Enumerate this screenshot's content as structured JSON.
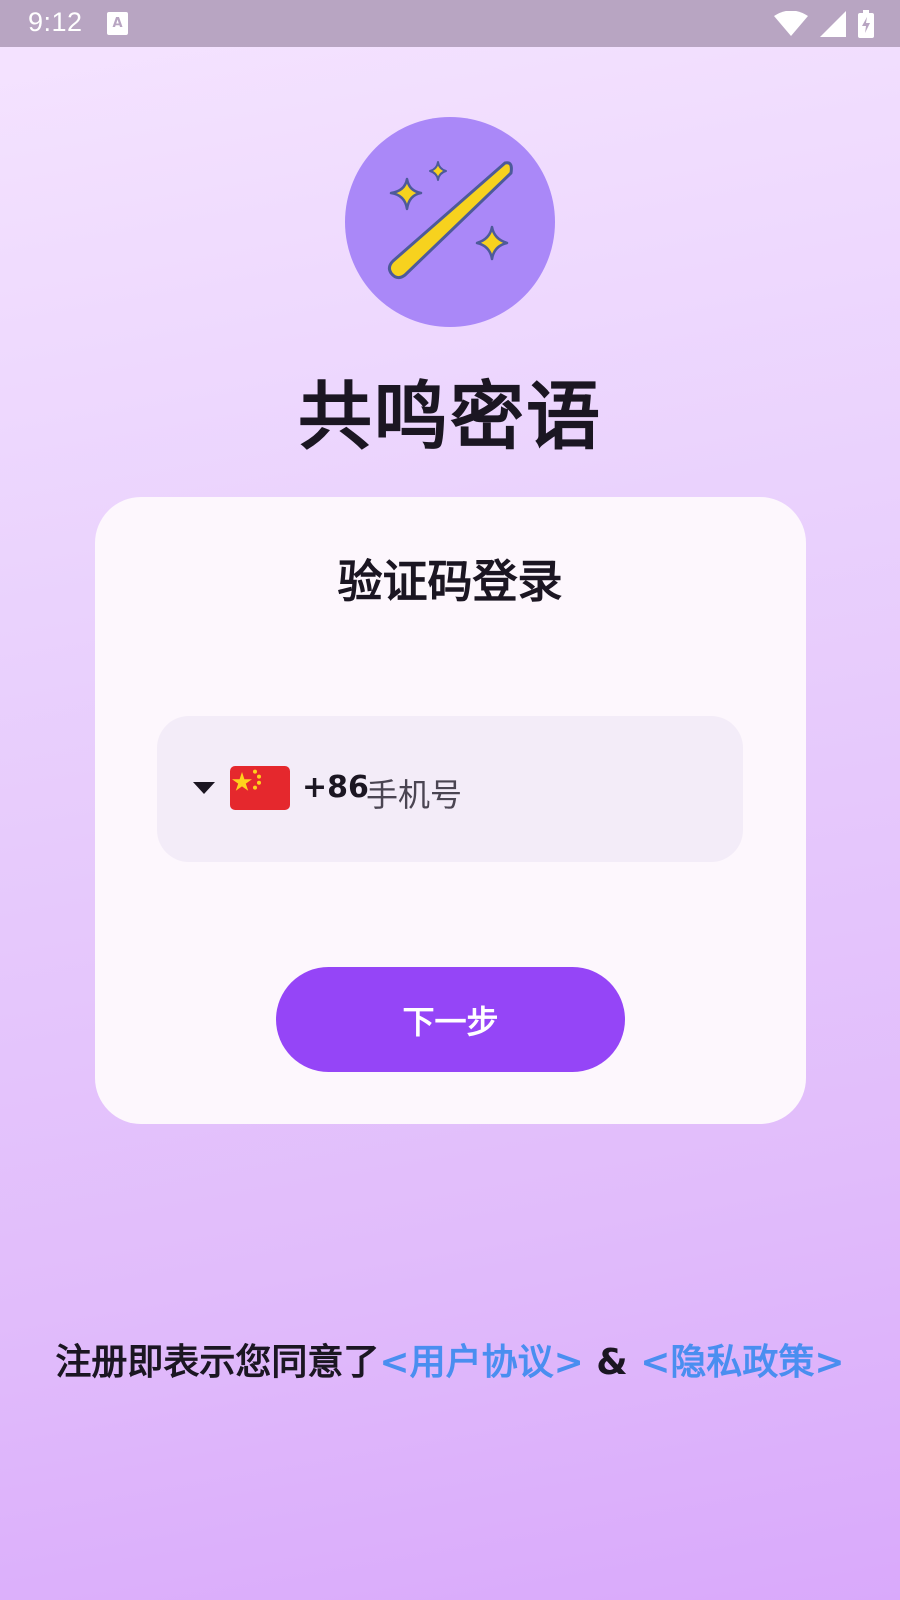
{
  "status_bar": {
    "time": "9:12"
  },
  "app": {
    "title": "共鸣密语",
    "logo_icon": "magic-wand-sparkles-icon"
  },
  "login": {
    "title": "验证码登录",
    "country": {
      "flag_icon": "china-flag-icon",
      "code": "+86"
    },
    "phone_placeholder": "手机号",
    "phone_value": "",
    "next_button": "下一步"
  },
  "agreement": {
    "prefix": "注册即表示您同意了",
    "user_agreement": "<用户协议>",
    "separator": " & ",
    "privacy_policy": "<隐私政策>"
  },
  "colors": {
    "primary": "#9545f7",
    "logo_bg": "#aa88f8",
    "link": "#4a8ef0",
    "wand": "#f7d21e"
  }
}
